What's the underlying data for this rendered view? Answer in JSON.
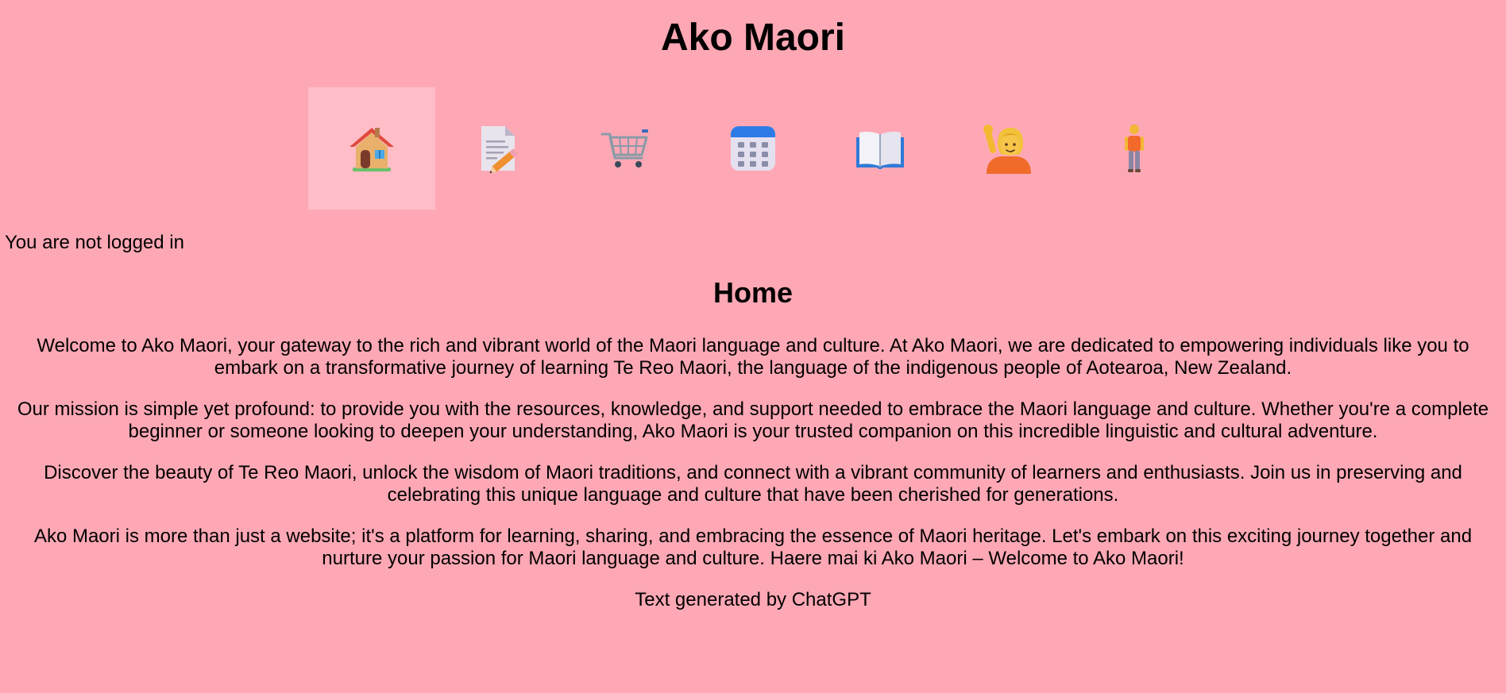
{
  "site": {
    "title": "Ako Maori"
  },
  "nav": {
    "items": [
      {
        "icon": "house-icon",
        "active": true
      },
      {
        "icon": "document-pencil-icon",
        "active": false
      },
      {
        "icon": "shopping-cart-icon",
        "active": false
      },
      {
        "icon": "calendar-icon",
        "active": false
      },
      {
        "icon": "open-book-icon",
        "active": false
      },
      {
        "icon": "person-raising-hand-icon",
        "active": false
      },
      {
        "icon": "person-standing-icon",
        "active": false
      }
    ]
  },
  "status": {
    "login_text": "You are not logged in"
  },
  "main": {
    "heading": "Home",
    "paragraphs": [
      "Welcome to Ako Maori, your gateway to the rich and vibrant world of the Maori language and culture. At Ako Maori, we are dedicated to empowering individuals like you to embark on a transformative journey of learning Te Reo Maori, the language of the indigenous people of Aotearoa, New Zealand.",
      "Our mission is simple yet profound: to provide you with the resources, knowledge, and support needed to embrace the Maori language and culture. Whether you're a complete beginner or someone looking to deepen your understanding, Ako Maori is your trusted companion on this incredible linguistic and cultural adventure.",
      "Discover the beauty of Te Reo Maori, unlock the wisdom of Maori traditions, and connect with a vibrant community of learners and enthusiasts. Join us in preserving and celebrating this unique language and culture that have been cherished for generations.",
      "Ako Maori is more than just a website; it's a platform for learning, sharing, and embracing the essence of Maori heritage. Let's embark on this exciting journey together and nurture your passion for Maori language and culture. Haere mai ki Ako Maori – Welcome to Ako Maori!",
      "Text generated by ChatGPT"
    ]
  },
  "colors": {
    "background": "#ffa8b5",
    "nav_active": "#ffbdc8"
  }
}
